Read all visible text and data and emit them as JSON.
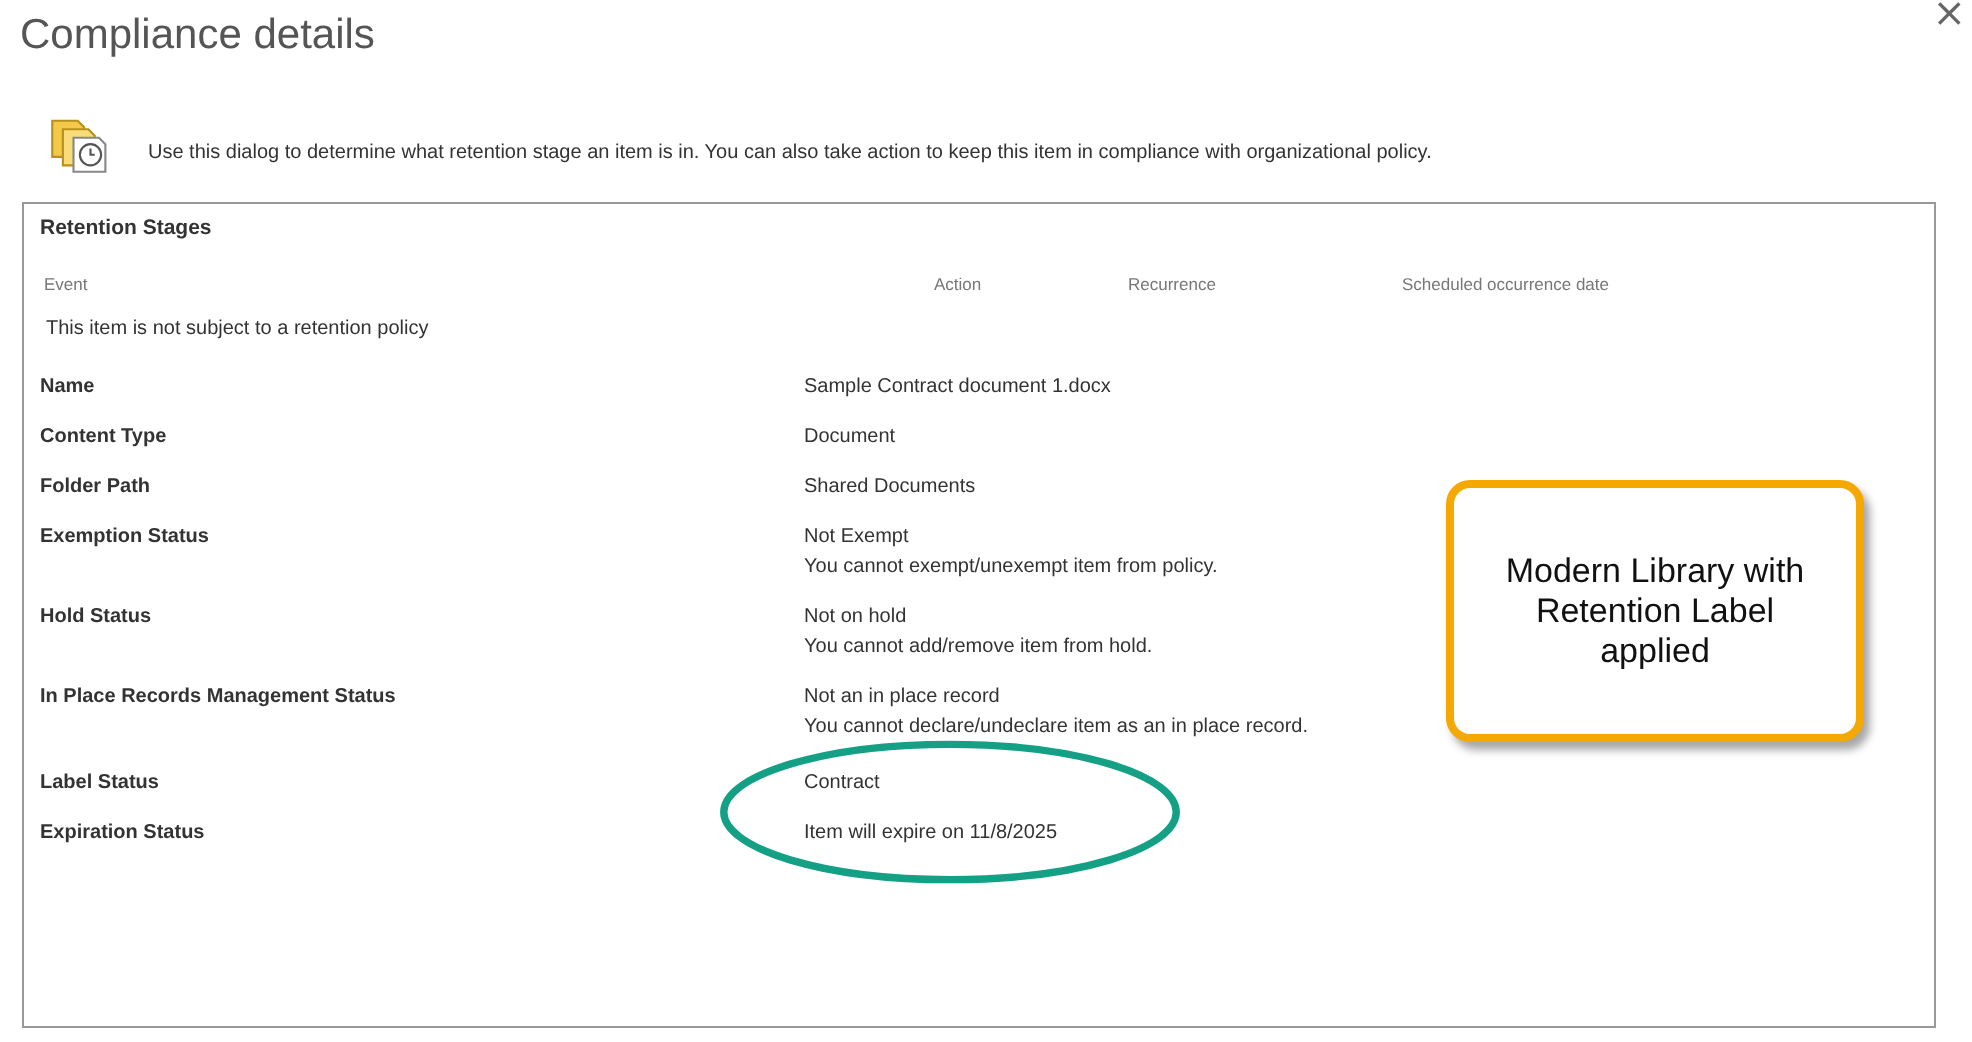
{
  "window": {
    "title": "Compliance details",
    "close": "×"
  },
  "description": "Use this dialog to determine what retention stage an item is in. You can also take action to keep this item in compliance with organizational policy.",
  "retention_stages": {
    "title": "Retention Stages",
    "columns": [
      "Event",
      "Action",
      "Recurrence",
      "Scheduled occurrence date"
    ],
    "message": "This item is not subject to a retention policy"
  },
  "properties": [
    {
      "label": "Name",
      "values": [
        "Sample Contract document 1.docx"
      ]
    },
    {
      "label": "Content Type",
      "values": [
        "Document"
      ]
    },
    {
      "label": "Folder Path",
      "values": [
        "Shared Documents"
      ]
    },
    {
      "label": "Exemption Status",
      "values": [
        "Not Exempt",
        "You cannot exempt/unexempt item from policy."
      ]
    },
    {
      "label": "Hold Status",
      "values": [
        "Not on hold",
        "You cannot add/remove item from hold."
      ]
    },
    {
      "label": "In Place Records Management Status",
      "values": [
        "Not an in place record",
        "You cannot declare/undeclare item as an in place record."
      ]
    },
    {
      "label": "Label Status",
      "values": [
        "Contract"
      ]
    },
    {
      "label": "Expiration Status",
      "values": [
        "Item will expire on 11/8/2025"
      ]
    }
  ],
  "callout": {
    "text": "Modern Library with Retention Label applied"
  }
}
